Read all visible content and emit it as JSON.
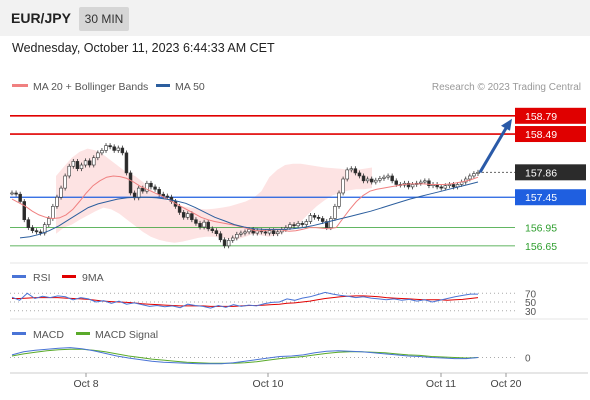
{
  "header": {
    "symbol": "EUR/JPY",
    "timeframe": "30 MIN",
    "datetime": "Wednesday, October 11, 2023 6:44:33 AM CET"
  },
  "legend": {
    "ma20_label": "MA 20 + Bollinger Bands",
    "ma50_label": "MA 50",
    "credit": "Research © 2023 Trading Central",
    "rsi_label": "RSI",
    "rsi_ma_label": "9MA",
    "macd_label": "MACD",
    "macd_signal_label": "MACD Signal"
  },
  "colors": {
    "ma20": "#f08080",
    "ma50": "#2c5e9e",
    "bollinger_fill": "#fde3e3",
    "resistance": "#e00000",
    "pivot": "#1f5fe0",
    "support": "#2e9e2e",
    "last_price_bg": "#2b2b2b",
    "arrow": "#2a5aa8",
    "rsi": "#4a74d6",
    "rsi_ma": "#e00000",
    "macd": "#4a74d6",
    "macd_signal": "#5aaa2a"
  },
  "chart_data": {
    "type": "candlestick",
    "x_ticks": [
      "Oct 8",
      "Oct 10",
      "Oct 11",
      "Oct 20"
    ],
    "ylim": [
      156.45,
      159.05
    ],
    "levels": [
      {
        "label": "158.79",
        "value": 158.79,
        "kind": "resistance"
      },
      {
        "label": "158.49",
        "value": 158.49,
        "kind": "resistance"
      },
      {
        "label": "157.86",
        "value": 157.86,
        "kind": "last"
      },
      {
        "label": "157.45",
        "value": 157.45,
        "kind": "pivot"
      },
      {
        "label": "156.95",
        "value": 156.95,
        "kind": "support"
      },
      {
        "label": "156.65",
        "value": 156.65,
        "kind": "support"
      }
    ],
    "close": [
      157.52,
      157.5,
      157.38,
      157.08,
      156.95,
      156.9,
      156.88,
      156.86,
      157.0,
      157.1,
      157.3,
      157.45,
      157.6,
      157.8,
      157.96,
      158.04,
      157.92,
      157.98,
      158.05,
      157.98,
      158.1,
      158.18,
      158.22,
      158.3,
      158.28,
      158.22,
      158.26,
      158.18,
      157.85,
      157.52,
      157.44,
      157.6,
      157.55,
      157.68,
      157.62,
      157.58,
      157.5,
      157.47,
      157.45,
      157.38,
      157.3,
      157.2,
      157.12,
      157.18,
      157.08,
      157.02,
      156.96,
      157.04,
      156.93,
      156.9,
      156.85,
      156.75,
      156.65,
      156.74,
      156.78,
      156.84,
      156.86,
      156.88,
      156.92,
      156.86,
      156.9,
      156.88,
      156.86,
      156.9,
      156.85,
      156.88,
      156.92,
      156.95,
      157.0,
      156.98,
      157.02,
      157.0,
      157.05,
      157.15,
      157.12,
      157.1,
      157.05,
      156.95,
      157.1,
      157.3,
      157.52,
      157.75,
      157.9,
      157.92,
      157.85,
      157.8,
      157.72,
      157.75,
      157.7,
      157.73,
      157.76,
      157.78,
      157.8,
      157.72,
      157.66,
      157.65,
      157.68,
      157.62,
      157.66,
      157.68,
      157.7,
      157.72,
      157.64,
      157.66,
      157.62,
      157.6,
      157.64,
      157.66,
      157.62,
      157.66,
      157.7,
      157.75,
      157.8,
      157.84,
      157.86
    ],
    "ma20": [
      157.42,
      157.36,
      157.3,
      157.22,
      157.16,
      157.12,
      157.1,
      157.11,
      157.16,
      157.25,
      157.38,
      157.52,
      157.64,
      157.72,
      157.78,
      157.8,
      157.79,
      157.76,
      157.7,
      157.63,
      157.58,
      157.53,
      157.48,
      157.42,
      157.36,
      157.3,
      157.24,
      157.18,
      157.12,
      157.08,
      157.05,
      157.03,
      157.01,
      156.99,
      156.96,
      156.93,
      156.9,
      156.9,
      156.91,
      156.92,
      156.91,
      156.89,
      156.9,
      156.92,
      156.95,
      156.95,
      156.94,
      156.93,
      156.95,
      157.1,
      157.25,
      157.38,
      157.48,
      157.55,
      157.58,
      157.6,
      157.62,
      157.64,
      157.66,
      157.67,
      157.67,
      157.67,
      157.66,
      157.66,
      157.66,
      157.67,
      157.69,
      157.71,
      157.74,
      157.78
    ],
    "ma50": [
      156.78,
      156.8,
      156.84,
      156.9,
      156.98,
      157.08,
      157.18,
      157.28,
      157.34,
      157.38,
      157.42,
      157.44,
      157.45,
      157.45,
      157.44,
      157.42,
      157.39,
      157.35,
      157.28,
      157.2,
      157.12,
      157.06,
      157.0,
      156.96,
      156.93,
      156.92,
      156.92,
      156.92,
      156.93,
      156.95,
      156.98,
      157.02,
      157.06,
      157.1,
      157.14,
      157.18,
      157.22,
      157.27,
      157.32,
      157.37,
      157.42,
      157.46,
      157.5,
      157.54,
      157.58,
      157.62,
      157.66,
      157.7
    ],
    "ma50_x_start_index": 2,
    "bb_upper": [
      157.8,
      157.95,
      158.1,
      158.2,
      158.25,
      158.22,
      158.15,
      158.05,
      157.95,
      157.85,
      157.8,
      157.7,
      157.58,
      157.48,
      157.4,
      157.34,
      157.3,
      157.28,
      157.26,
      157.25,
      157.26,
      157.28,
      157.3,
      157.34,
      157.38,
      157.44,
      157.55,
      157.78,
      157.9,
      157.98,
      158.0,
      158.0,
      157.98,
      157.96,
      157.94,
      157.93,
      157.92,
      157.9,
      157.9,
      157.92,
      157.94
    ],
    "bb_lower": [
      156.85,
      156.95,
      157.0,
      157.08,
      157.15,
      157.22,
      157.28,
      157.25,
      157.18,
      157.08,
      156.98,
      156.88,
      156.8,
      156.75,
      156.72,
      156.7,
      156.72,
      156.75,
      156.78,
      156.8,
      156.8,
      156.78,
      156.76,
      156.76,
      156.8,
      156.85,
      156.82,
      156.8,
      156.83,
      156.88,
      156.95,
      157.05,
      157.18,
      157.3,
      157.4,
      157.48,
      157.52,
      157.56,
      157.58,
      157.58,
      157.6
    ],
    "rsi": {
      "labels": [
        "70",
        "50",
        "30"
      ],
      "values": [
        70,
        50,
        30
      ],
      "ylim": [
        18,
        82
      ],
      "series_rsi": [
        61,
        54,
        70,
        58,
        63,
        60,
        64,
        62,
        55,
        60,
        57,
        50,
        53,
        47,
        52,
        45,
        48,
        44,
        40,
        42,
        39,
        41,
        37,
        45,
        42,
        40,
        36,
        42,
        38,
        44,
        40,
        43,
        41,
        46,
        49,
        50,
        57,
        54,
        59,
        62,
        67,
        72,
        68,
        65,
        63,
        60,
        62,
        59,
        57,
        55,
        57,
        54,
        56,
        52,
        55,
        50,
        54,
        58,
        62,
        65,
        68,
        68
      ],
      "series_ma": [
        58,
        58,
        59,
        60,
        60,
        60,
        60,
        59,
        58,
        57,
        56,
        54,
        52,
        51,
        50,
        49,
        48,
        46,
        45,
        44,
        43,
        42,
        41,
        41,
        41,
        41,
        40,
        40,
        40,
        40,
        41,
        42,
        42,
        43,
        44,
        45,
        47,
        48,
        50,
        52,
        55,
        58,
        60,
        62,
        63,
        64,
        64,
        63,
        62,
        60,
        59,
        58,
        57,
        56,
        55,
        55,
        55,
        54,
        55,
        56,
        58,
        60
      ]
    },
    "macd": {
      "labels": [
        "0"
      ],
      "zero": 0,
      "ylim": [
        -0.24,
        0.26
      ],
      "series_macd": [
        0.05,
        0.11,
        0.14,
        0.16,
        0.18,
        0.19,
        0.17,
        0.13,
        0.08,
        0.03,
        -0.01,
        -0.04,
        -0.07,
        -0.09,
        -0.1,
        -0.11,
        -0.12,
        -0.12,
        -0.12,
        -0.1,
        -0.07,
        -0.04,
        -0.01,
        0.02,
        0.03,
        0.05,
        0.09,
        0.12,
        0.13,
        0.12,
        0.11,
        0.09,
        0.07,
        0.05,
        0.03,
        0.02,
        0.0,
        -0.01,
        -0.02,
        -0.02,
        0.0
      ],
      "series_signal": [
        0.03,
        0.07,
        0.1,
        0.13,
        0.15,
        0.16,
        0.16,
        0.14,
        0.11,
        0.07,
        0.03,
        0.0,
        -0.03,
        -0.05,
        -0.07,
        -0.09,
        -0.1,
        -0.11,
        -0.11,
        -0.11,
        -0.1,
        -0.08,
        -0.05,
        -0.02,
        0.0,
        0.02,
        0.05,
        0.08,
        0.1,
        0.11,
        0.11,
        0.1,
        0.09,
        0.07,
        0.05,
        0.04,
        0.02,
        0.01,
        0.0,
        -0.01,
        0.0
      ]
    }
  }
}
